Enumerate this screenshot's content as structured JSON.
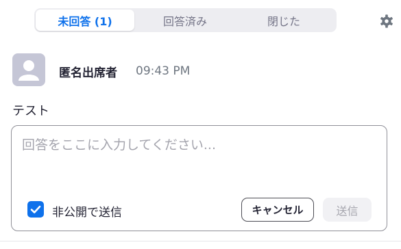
{
  "tabs": [
    {
      "label": "未回答 (1)",
      "active": true
    },
    {
      "label": "回答済み",
      "active": false
    },
    {
      "label": "閉じた",
      "active": false
    }
  ],
  "settings_icon": "gear-icon",
  "message": {
    "avatar_icon": "user-silhouette-icon",
    "sender": "匿名出席者",
    "time": "09:43 PM",
    "question": "テスト"
  },
  "reply": {
    "placeholder": "回答をここに入力してください...",
    "private_label": "非公開で送信",
    "private_checked": true,
    "cancel_label": "キャンセル",
    "send_label": "送信"
  },
  "colors": {
    "accent": "#0e71eb",
    "tab_bg": "#ededf1",
    "avatar_bg": "#c5c6d6"
  }
}
